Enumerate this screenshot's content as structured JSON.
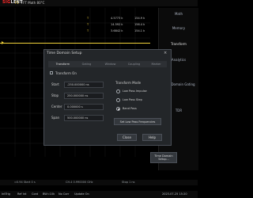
{
  "top": {
    "logo_red": "SIG",
    "logo_white": "LENT",
    "trigger": "F1",
    "trigger_info": "FFT Math 80°C",
    "readout_small": "T"
  },
  "right_panel": {
    "math": "Math",
    "memory": "Memory",
    "transform": "Transform",
    "analytics": "Analytics",
    "time_domain_gating": "Time Domain Gating",
    "tdr": "TDR"
  },
  "measurements": [
    {
      "mark": "T",
      "v1": "4.5773 k",
      "v2": "154.9 k"
    },
    {
      "mark": "T",
      "v1": "14.592 k",
      "v2": "156.4 k"
    },
    {
      "mark": "T",
      "v1": "3.6842 k",
      "v2": "154.1 k"
    },
    {
      "mark": "T",
      "v1": "",
      "v2": ""
    }
  ],
  "dialog": {
    "title": "Time Domain Setup",
    "close_x": "×",
    "tabs": [
      "Transform",
      "Gating",
      "Window",
      "Coupling",
      "Marker"
    ],
    "transform_on": "Transform On",
    "fields": [
      {
        "label": "Start",
        "value": "-250.000000 ns"
      },
      {
        "label": "Stop",
        "value": "250.000000 ns"
      },
      {
        "label": "Center",
        "value": "0.000000 s"
      },
      {
        "label": "Span",
        "value": "500.000000 ns"
      }
    ],
    "mode_title": "Transform Mode",
    "modes": [
      {
        "label": "Low Pass Impulse",
        "selected": false
      },
      {
        "label": "Low Pass Step",
        "selected": false
      },
      {
        "label": "Band Pass",
        "selected": true
      }
    ],
    "set_freq": "Set Low Pass Frequencies",
    "close": "Close",
    "help": "Help"
  },
  "bottom_button": "Time Domain Setup...",
  "statusrow": {
    "left": "≈0.94 Start 0 s",
    "mid": "CH.4 0.990000 GHz",
    "right": "Stop 1 ns"
  },
  "bottombar": {
    "items": [
      "IntTrig",
      "Ref Int",
      "Cont",
      "BW=10k",
      "No Corr",
      "Update On"
    ],
    "datetime": "2023-07-25 15:20"
  },
  "colors": {
    "accent_yellow": "#f2d33a",
    "red": "#ff2a2a"
  }
}
